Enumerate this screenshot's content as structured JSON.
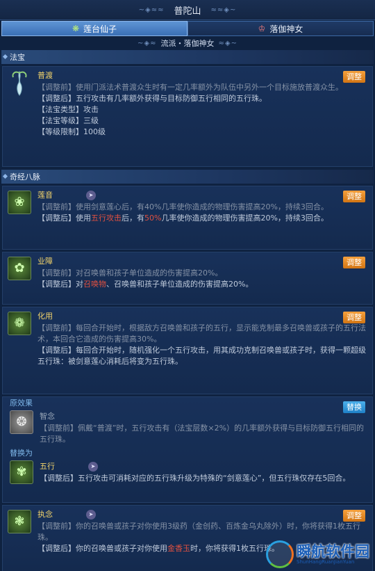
{
  "title": "普陀山",
  "tabs": [
    {
      "label": "莲台仙子"
    },
    {
      "label": "落伽神女"
    }
  ],
  "faction": "流派・落伽神女",
  "sections": {
    "fabao": "法宝",
    "meridian": "奇经八脉"
  },
  "buttons": {
    "adjust": "调整",
    "replace": "替换"
  },
  "fabao": {
    "name": "普渡",
    "before": "【调整前】使用门派法术普渡众生时有一定几率额外为队伍中另外一个目标施放普渡众生。",
    "after": "【调整后】五行攻击有几率额外获得与目标防御五行相同的五行珠。",
    "type": "【法宝类型】攻击",
    "level": "【法宝等级】三级",
    "limit": "【等级限制】100级"
  },
  "skills": [
    {
      "name": "莲音",
      "before": "【调整前】使用剑意莲心后，有40%几率使你造成的物理伤害提高20%，持续3回合。",
      "after_a": "【调整后】使用",
      "after_h1": "五行攻击",
      "after_b": "后，有",
      "after_h2": "50%",
      "after_c": "几率使你造成的物理伤害提高20%，持续3回合。"
    },
    {
      "name": "业障",
      "before": "【调整前】对召唤兽和孩子单位造成的伤害提高20%。",
      "after_a": "【调整后】对",
      "after_h1": "召唤物",
      "after_b": "、召唤兽和孩子单位造成的伤害提高20%。"
    },
    {
      "name": "化用",
      "before": "【调整前】每回合开始时，根据敌方召唤兽和孩子的五行，显示能克制最多召唤兽或孩子的五行法术，本回合它造成的伤害提高30%。",
      "after": "【调整后】每回合开始时，随机强化一个五行攻击，用其成功克制召唤兽或孩子时，获得一颗超级五行珠：被剑意莲心消耗后将变为五行珠。"
    }
  ],
  "original": {
    "label": "原效果",
    "name": "智念",
    "text": "【调整前】佩戴“普渡”时，五行攻击有（法宝层数×2%）的几率额外获得与目标防御五行相同的五行珠。"
  },
  "replace": {
    "label": "替换为",
    "name": "五行",
    "text": "【调整后】五行攻击可消耗对应的五行珠升级为特殊的“剑意莲心”，但五行珠仅存在5回合。"
  },
  "last": {
    "name": "执念",
    "before": "【调整前】你的召唤兽或孩子对你使用3级药（金创药、百炼金乌丸除外）时，你将获得1枚五行珠。",
    "after_a": "【调整后】你的召唤兽或孩子对你使用",
    "after_h": "金香玉",
    "after_b": "时，你将获得1枚五行珠。"
  },
  "watermark": {
    "text": "瞬航软件园",
    "sub": "ShunHangRuanJianYuan"
  }
}
